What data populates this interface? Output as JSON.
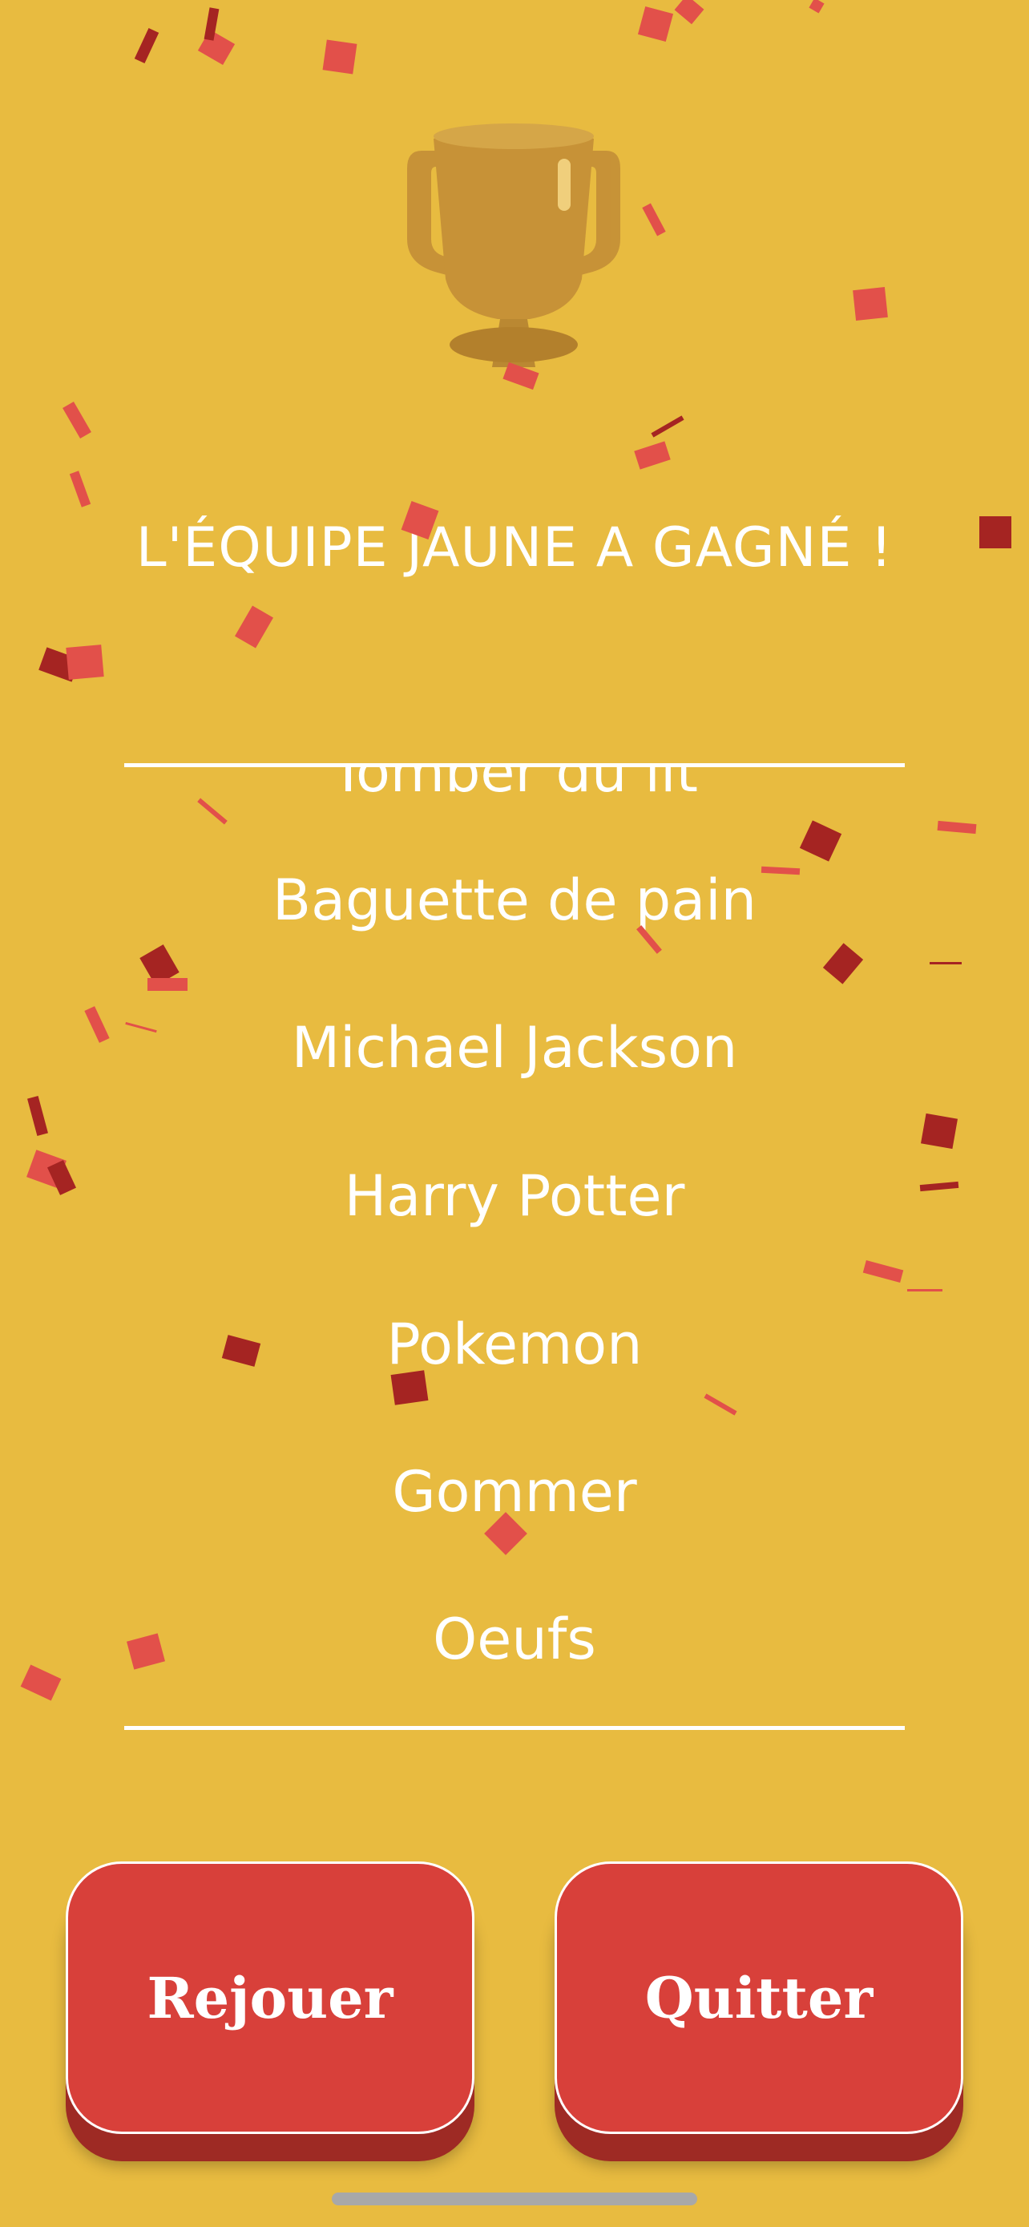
{
  "colors": {
    "background": "#E8BB40",
    "button": "#D8403A",
    "button_shadow": "#9E2A24",
    "text": "#FFFFFF",
    "trophy": "#C08A36",
    "confetti_light": "#E2504A",
    "confetti_dark": "#A52422"
  },
  "icons": {
    "trophy": "trophy-icon"
  },
  "result": {
    "title": "L'ÉQUIPE JAUNE A GAGNÉ !"
  },
  "words": [
    "Tomber du lit",
    "Baguette de pain",
    "Michael Jackson",
    "Harry Potter",
    "Pokemon",
    "Gommer",
    "Oeufs"
  ],
  "buttons": {
    "replay": "Rejouer",
    "quit": "Quitter"
  }
}
